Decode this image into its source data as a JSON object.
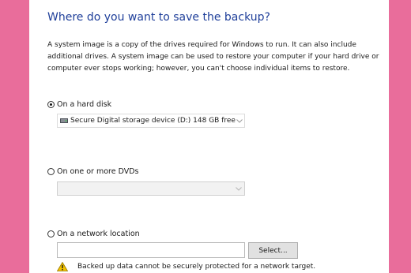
{
  "dialog": {
    "title": "Where do you want to save the backup?",
    "description": "A system image is a copy of the drives required for Windows to run. It can also include additional drives. A system image can be used to restore your computer if your hard drive or computer ever stops working; however, you can't choose individual items to restore."
  },
  "options": {
    "hard_disk": {
      "label": "On a hard disk",
      "selected": true,
      "drive_value": "Secure Digital storage device (D:)  148 GB  free"
    },
    "dvds": {
      "label": "On one or more DVDs",
      "selected": false,
      "drive_value": ""
    },
    "network": {
      "label": "On a network location",
      "selected": false,
      "path_value": "",
      "select_button_label": "Select...",
      "warning_text": "Backed up data cannot be securely protected for a network target."
    }
  },
  "colors": {
    "background": "#e96d9b",
    "title": "#1f3f9a",
    "warning": "#f2c200"
  },
  "icons": {
    "drive": "drive-icon",
    "chevron": "chevron-down-icon",
    "warning": "warning-icon"
  }
}
